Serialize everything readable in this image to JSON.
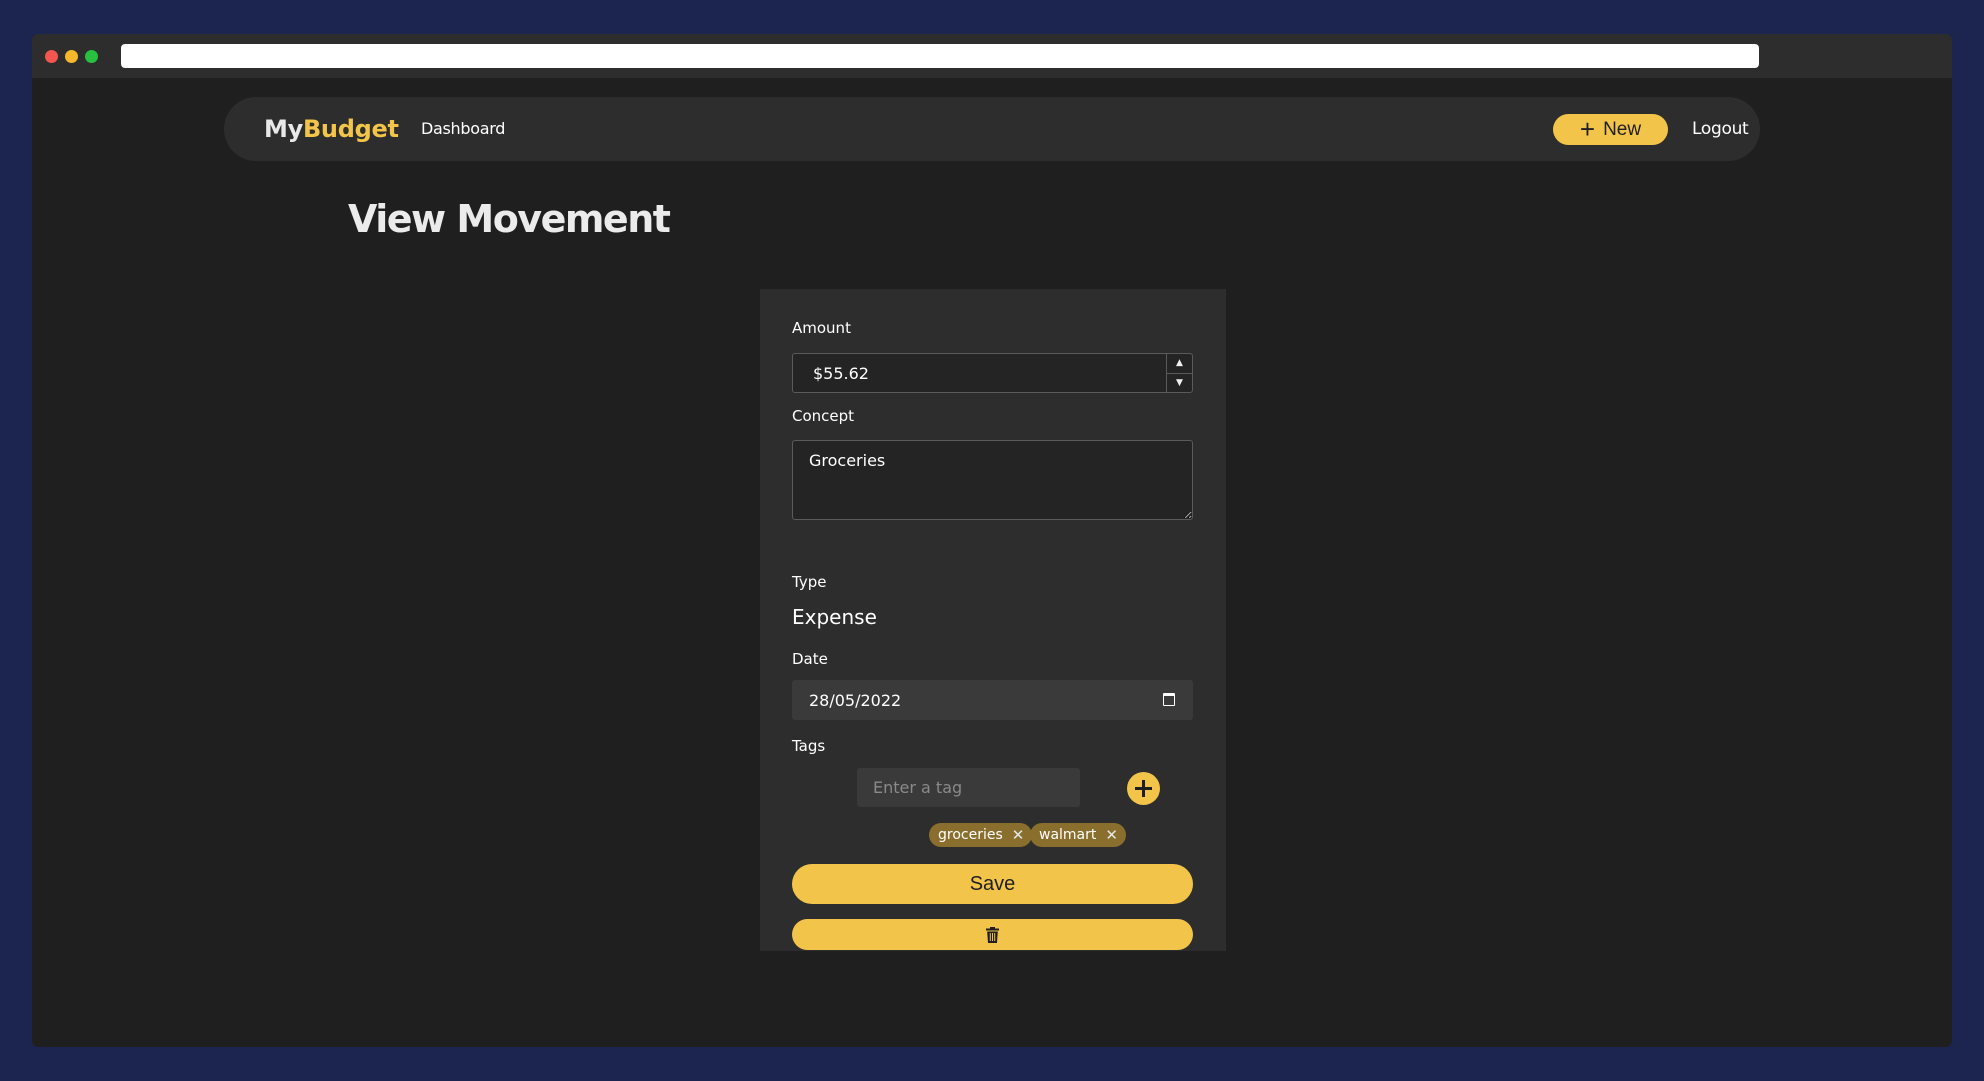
{
  "brand": {
    "part1": "My",
    "part2": "Budget"
  },
  "nav": {
    "dashboard": "Dashboard",
    "new_label": "New",
    "logout": "Logout"
  },
  "page": {
    "title": "View Movement"
  },
  "form": {
    "amount": {
      "label": "Amount",
      "value": "$55.62"
    },
    "concept": {
      "label": "Concept",
      "value": "Groceries"
    },
    "type": {
      "label": "Type",
      "value": "Expense"
    },
    "date": {
      "label": "Date",
      "value": "28/05/2022"
    },
    "tags": {
      "label": "Tags",
      "placeholder": "Enter a tag",
      "items": [
        "groceries",
        "walmart"
      ]
    },
    "save_label": "Save"
  },
  "icons": {
    "new": "plus-icon",
    "spinner_up": "caret-up-icon",
    "spinner_down": "caret-down-icon",
    "date": "calendar-icon",
    "add_tag": "plus-circle-icon",
    "remove_tag": "close-icon",
    "delete": "trash-icon"
  },
  "colors": {
    "accent": "#f3c44a",
    "background": "#1f1f1f",
    "surface": "#2d2d2d",
    "tag_chip": "#8a6e2e",
    "outer_background": "#1c2550"
  }
}
